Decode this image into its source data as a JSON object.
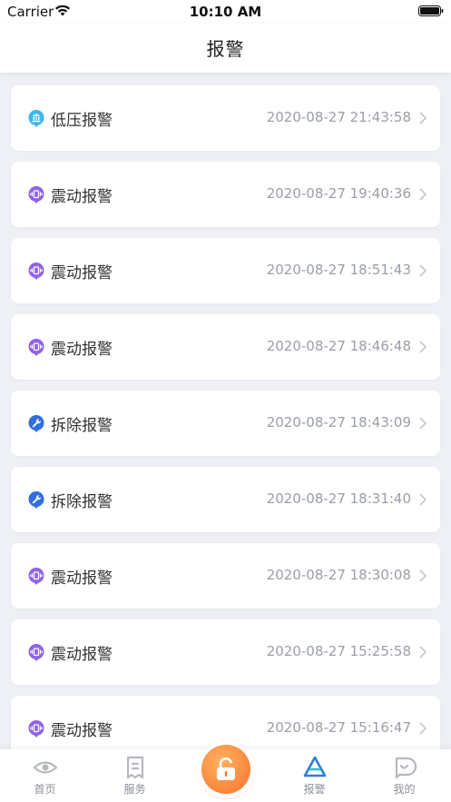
{
  "status_bar": {
    "carrier": "Carrier",
    "time": "10:10 AM"
  },
  "header": {
    "title": "报警"
  },
  "alarms": [
    {
      "type": "low-pressure",
      "title": "低压报警",
      "time": "2020-08-27 21:43:58",
      "icon": "building-pin-icon",
      "color": "#3eb6ef"
    },
    {
      "type": "vibration",
      "title": "震动报警",
      "time": "2020-08-27 19:40:36",
      "icon": "vibration-pin-icon",
      "color": "#8f63e6"
    },
    {
      "type": "vibration",
      "title": "震动报警",
      "time": "2020-08-27 18:51:43",
      "icon": "vibration-pin-icon",
      "color": "#8f63e6"
    },
    {
      "type": "vibration",
      "title": "震动报警",
      "time": "2020-08-27 18:46:48",
      "icon": "vibration-pin-icon",
      "color": "#8f63e6"
    },
    {
      "type": "removal",
      "title": "拆除报警",
      "time": "2020-08-27 18:43:09",
      "icon": "wrench-pin-icon",
      "color": "#2f6fe0"
    },
    {
      "type": "removal",
      "title": "拆除报警",
      "time": "2020-08-27 18:31:40",
      "icon": "wrench-pin-icon",
      "color": "#2f6fe0"
    },
    {
      "type": "vibration",
      "title": "震动报警",
      "time": "2020-08-27 18:30:08",
      "icon": "vibration-pin-icon",
      "color": "#8f63e6"
    },
    {
      "type": "vibration",
      "title": "震动报警",
      "time": "2020-08-27 15:25:58",
      "icon": "vibration-pin-icon",
      "color": "#8f63e6"
    },
    {
      "type": "vibration",
      "title": "震动报警",
      "time": "2020-08-27 15:16:47",
      "icon": "vibration-pin-icon",
      "color": "#8f63e6"
    }
  ],
  "tab_bar": {
    "tabs": [
      {
        "label": "首页",
        "icon": "eye-icon",
        "active": false
      },
      {
        "label": "服务",
        "icon": "receipt-icon",
        "active": false
      },
      {
        "label": "",
        "icon": "unlock-icon",
        "active": false
      },
      {
        "label": "报警",
        "icon": "alarm-triangle-icon",
        "active": true
      },
      {
        "label": "我的",
        "icon": "profile-icon",
        "active": false
      }
    ]
  },
  "colors": {
    "accent": "#2e7fd3",
    "unlock_button": "#f7732c",
    "background": "#eef0f5"
  }
}
